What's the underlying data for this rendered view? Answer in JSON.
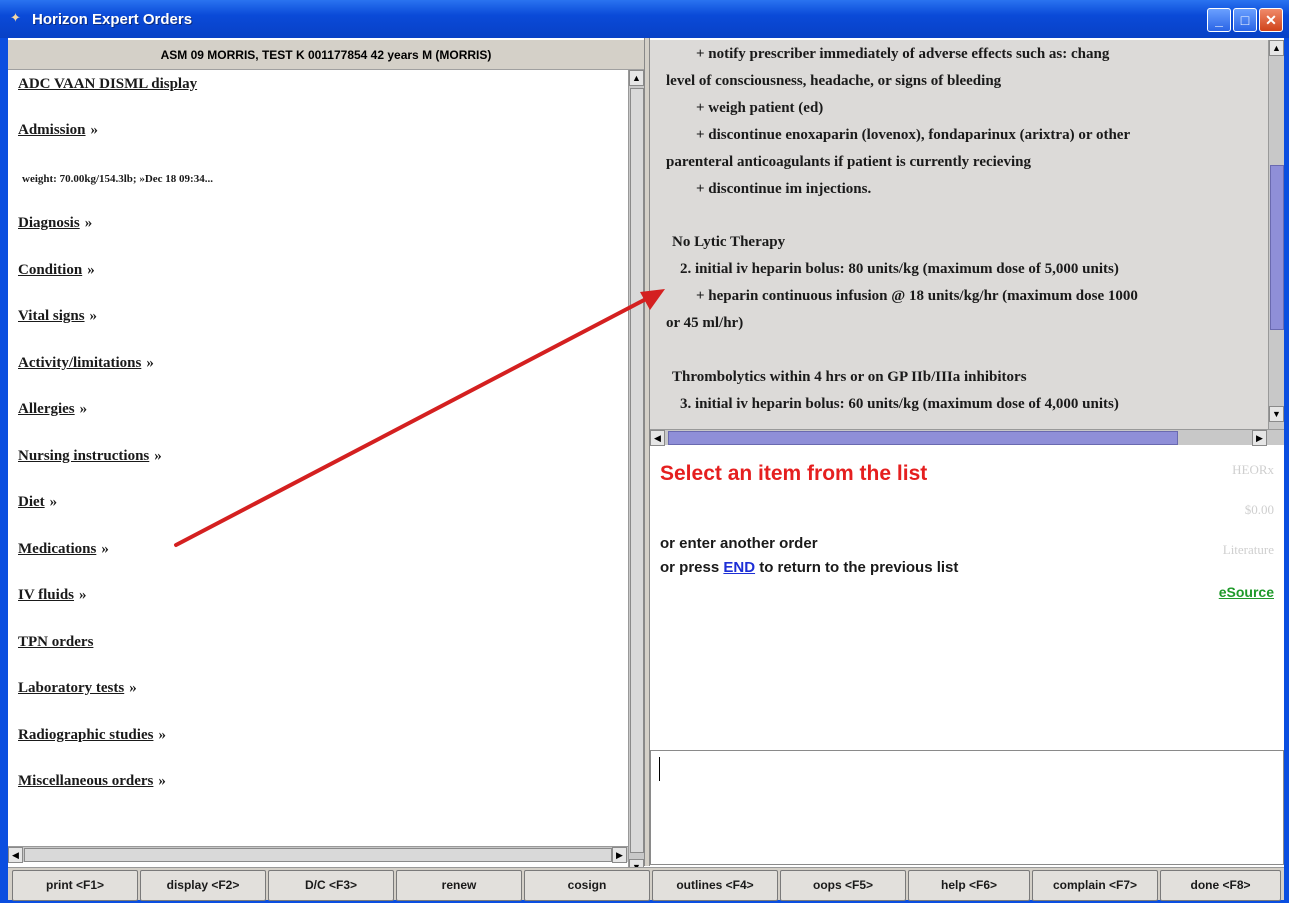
{
  "window": {
    "title": "Horizon Expert Orders",
    "minimize_label": "_",
    "maximize_label": "□",
    "close_label": "✕"
  },
  "patient_header": "ASM 09   MORRIS, TEST K   001177854   42 years  M   (MORRIS)",
  "left_menu": {
    "items": [
      {
        "label": "ADC VAAN DISML display",
        "arrow": ""
      },
      {
        "label": "Admission",
        "arrow": "»"
      },
      {
        "label": "weight: 70.00kg/154.3lb; »Dec 18 09:34...",
        "arrow": ""
      },
      {
        "label": "Diagnosis",
        "arrow": "»"
      },
      {
        "label": "Condition",
        "arrow": "»"
      },
      {
        "label": "Vital signs",
        "arrow": "»"
      },
      {
        "label": "Activity/limitations",
        "arrow": "»"
      },
      {
        "label": "Allergies",
        "arrow": "»"
      },
      {
        "label": "Nursing instructions",
        "arrow": "»"
      },
      {
        "label": "Diet",
        "arrow": "»"
      },
      {
        "label": "Medications",
        "arrow": "»"
      },
      {
        "label": "IV fluids",
        "arrow": "»"
      },
      {
        "label": "TPN orders",
        "arrow": ""
      },
      {
        "label": "Laboratory tests",
        "arrow": "»"
      },
      {
        "label": "Radiographic studies",
        "arrow": "»"
      },
      {
        "label": "Miscellaneous orders",
        "arrow": "»"
      }
    ]
  },
  "order_text": {
    "lines": [
      "+ notify prescriber immediately of adverse effects such as: chang",
      "level of consciousness, headache, or signs of bleeding",
      "+ weigh patient (ed)",
      "+ discontinue enoxaparin (lovenox), fondaparinux (arixtra) or other",
      "parenteral anticoagulants if patient is currently recieving",
      "+ discontinue im injections.",
      "No Lytic Therapy",
      "2. initial iv heparin bolus:  80 units/kg (maximum dose of 5,000 units)",
      "+ heparin continuous infusion @ 18 units/kg/hr (maximum dose 1000",
      "or 45 ml/hr)",
      "Thrombolytics within 4 hrs or on GP IIb/IIIa inhibitors",
      "3. initial iv heparin bolus:  60 units/kg (maximum dose of 4,000 units)"
    ]
  },
  "selection": {
    "prompt": "Select an item from the list",
    "hint1": "or enter another order",
    "hint2_pre": "or press ",
    "hint2_link": "END",
    "hint2_post": " to return to the previous list"
  },
  "side_links": {
    "heorx": "HEORx",
    "price": "$0.00",
    "literature": "Literature",
    "esource": "eSource"
  },
  "footer_buttons": [
    "print  <F1>",
    "display  <F2>",
    "D/C  <F3>",
    "renew",
    "cosign",
    "outlines <F4>",
    "oops  <F5>",
    "help  <F6>",
    "complain <F7>",
    "done  <F8>"
  ],
  "colors": {
    "accent_red": "#e51f1f",
    "link_blue": "#1d2fd6",
    "esource_green": "#1f9a2a",
    "title_blue": "#0a4ee0",
    "annotation_arrow": "#d42020"
  }
}
